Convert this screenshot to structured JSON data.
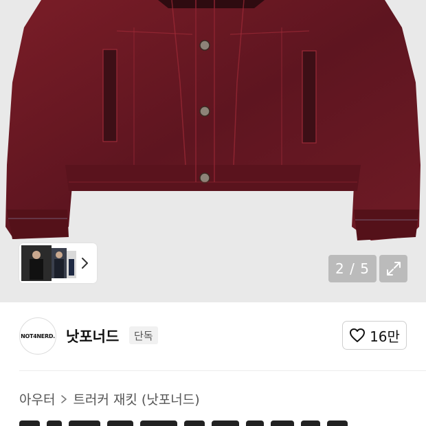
{
  "gallery": {
    "counter": "2 / 5",
    "colors": {
      "jacket": "#6b1a22",
      "jacket_dark": "#3d0f16",
      "background": "#e9e9e9"
    }
  },
  "seller": {
    "logo_text": "NOT4NERD.",
    "name": "낫포너드",
    "badge": "단독",
    "likes": "16만"
  },
  "breadcrumb": {
    "category": "아우터",
    "subcategory": "트러커 재킷 (낫포너드)"
  },
  "icons": [
    "chevron-right-icon",
    "expand-icon",
    "heart-icon"
  ]
}
